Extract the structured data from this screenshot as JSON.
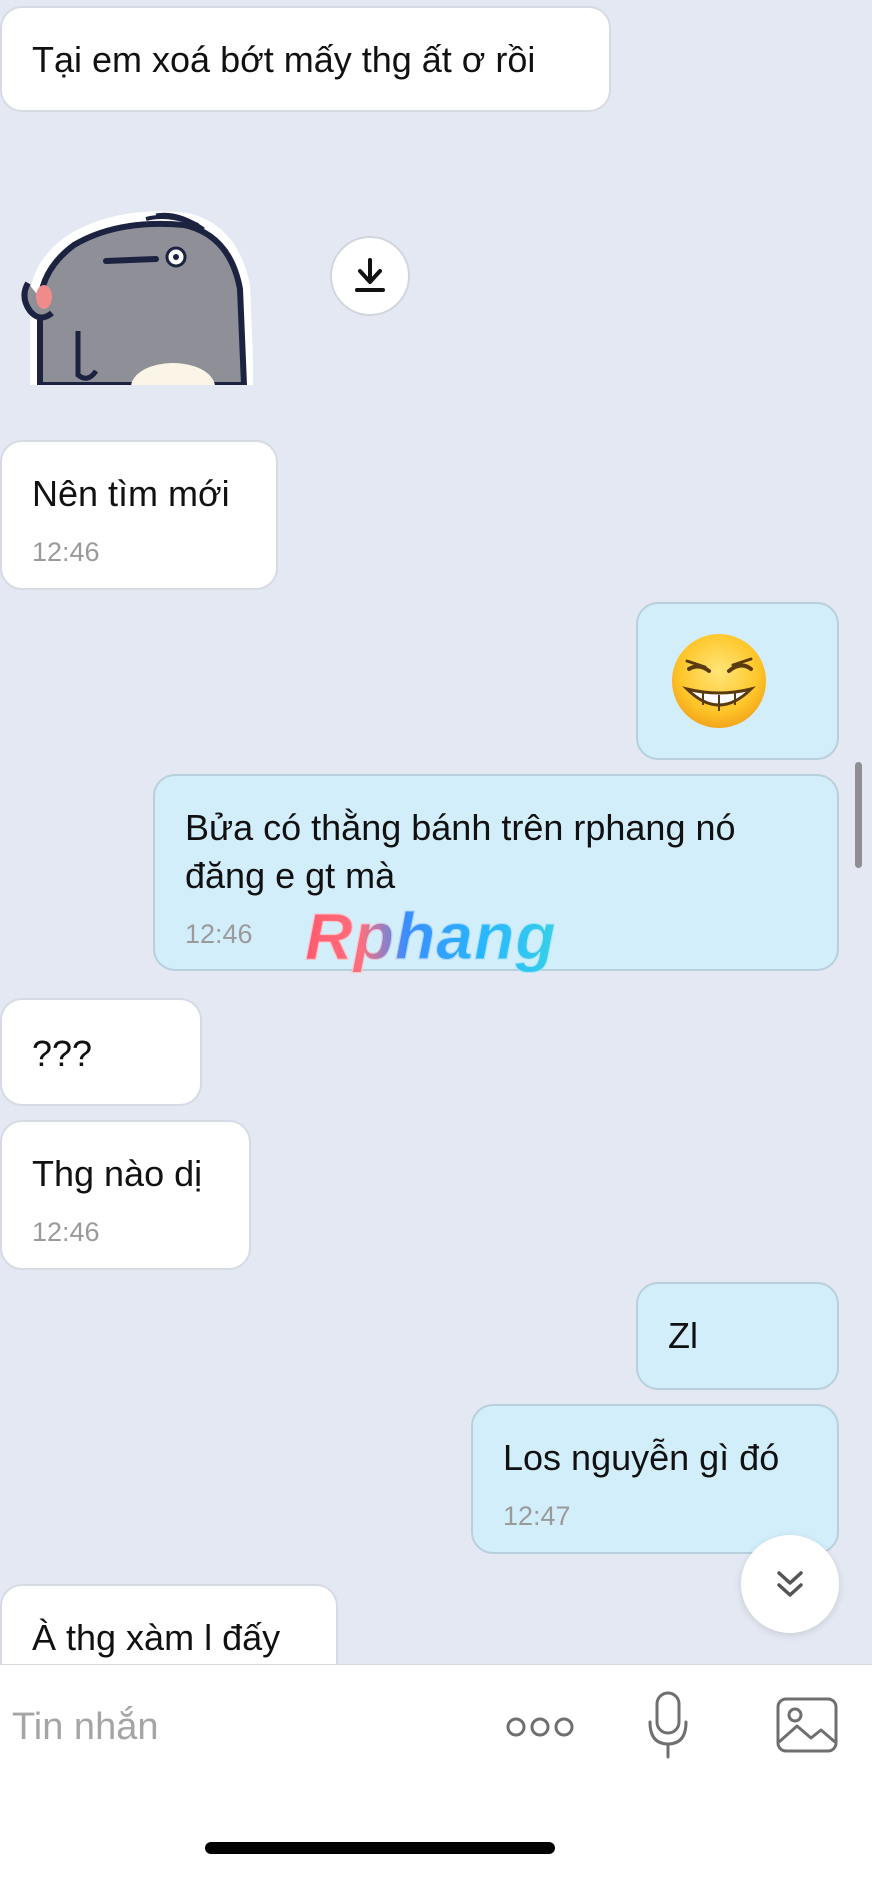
{
  "messages": [
    {
      "text": "Tại em xoá bớt mấy thg ất ơ rồi"
    },
    {
      "text": "Nên tìm mới",
      "time": "12:46"
    },
    {
      "emoji": "😆"
    },
    {
      "line1": "Bửa có thằng bánh trên rphang nó",
      "line2": "đăng e gt mà",
      "time": "12:46"
    },
    {
      "text": "???"
    },
    {
      "text": "Thg nào dị",
      "time": "12:46"
    },
    {
      "text": "Zl"
    },
    {
      "text": "Los nguyễn gì đó",
      "time": "12:47"
    },
    {
      "text": "À thg xàm l đấy"
    }
  ],
  "watermark": "Rphang",
  "composer": {
    "placeholder": "Tin nhắn"
  },
  "icons": {
    "download": "download-icon",
    "scroll_down": "chevron-double-down-icon",
    "more": "more-dots-icon",
    "mic": "microphone-icon",
    "image": "image-icon"
  },
  "colors": {
    "background": "#e3e8f2",
    "incoming_bubble": "#ffffff",
    "outgoing_bubble": "#d3eefb"
  }
}
